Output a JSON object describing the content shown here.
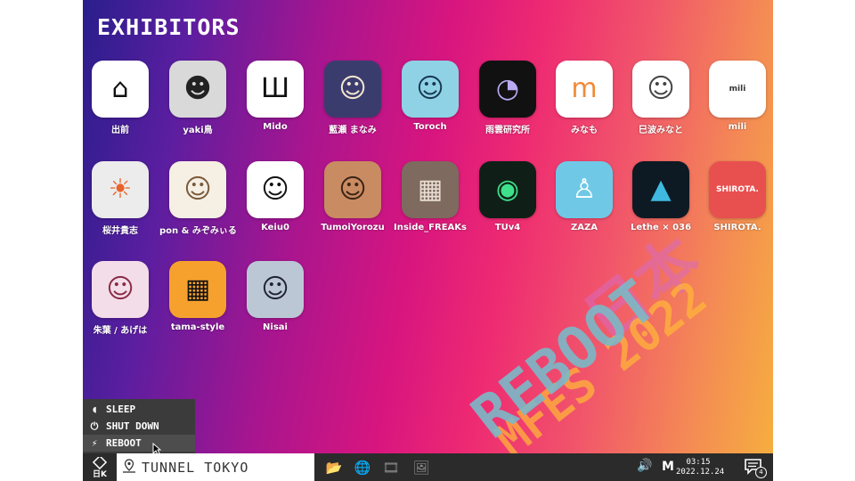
{
  "desktop": {
    "title": "EXHIBITORS",
    "apps": [
      {
        "label": "出前",
        "tile_bg": "#ffffff",
        "tile_fg": "#111111",
        "glyph": "⌂"
      },
      {
        "label": "yaki鳥",
        "tile_bg": "#d9d9d9",
        "tile_fg": "#222222",
        "glyph": "☻"
      },
      {
        "label": "Mido",
        "tile_bg": "#ffffff",
        "tile_fg": "#111111",
        "glyph": "Ш"
      },
      {
        "label": "藍瀬 まなみ",
        "tile_bg": "#3b3c6e",
        "tile_fg": "#f3e6d0",
        "glyph": "☺"
      },
      {
        "label": "Toroch",
        "tile_bg": "#8fd2e6",
        "tile_fg": "#17384f",
        "glyph": "☺"
      },
      {
        "label": "雨雲研究所",
        "tile_bg": "#111111",
        "tile_fg": "#b9a9f3",
        "glyph": "◔"
      },
      {
        "label": "みなも",
        "tile_bg": "#ffffff",
        "tile_fg": "#f08b3a",
        "glyph": "m"
      },
      {
        "label": "巳波みなと",
        "tile_bg": "#ffffff",
        "tile_fg": "#444444",
        "glyph": "☺"
      },
      {
        "label": "mili",
        "tile_bg": "#ffffff",
        "tile_fg": "#333333",
        "glyph": "mili"
      },
      {
        "label": "桜井貴志",
        "tile_bg": "#ececec",
        "tile_fg": "#e8632a",
        "glyph": "☀"
      },
      {
        "label": "pon & みぞみぃる",
        "tile_bg": "#f5efe4",
        "tile_fg": "#7a5a3a",
        "glyph": "☺"
      },
      {
        "label": "Keiu0",
        "tile_bg": "#ffffff",
        "tile_fg": "#111111",
        "glyph": "☺"
      },
      {
        "label": "TumoiYorozu",
        "tile_bg": "#c98b62",
        "tile_fg": "#3a2315",
        "glyph": "☺"
      },
      {
        "label": "Inside_FREAKs",
        "tile_bg": "#7e6a5f",
        "tile_fg": "#e8ddd2",
        "glyph": "▦"
      },
      {
        "label": "TUv4",
        "tile_bg": "#0f1f17",
        "tile_fg": "#3fe08a",
        "glyph": "◉"
      },
      {
        "label": "ZAZA",
        "tile_bg": "#6fc9e6",
        "tile_fg": "#ffffff",
        "glyph": "♙"
      },
      {
        "label": "Lethe × 036",
        "tile_bg": "#0d1a24",
        "tile_fg": "#3fb9e0",
        "glyph": "▲"
      },
      {
        "label": "SHIROTA.",
        "tile_bg": "#e8504f",
        "tile_fg": "#ffffff",
        "glyph": "SHIROTA."
      },
      {
        "label": "朱葉 / あげは",
        "tile_bg": "#f3dde8",
        "tile_fg": "#8a2b46",
        "glyph": "☺"
      },
      {
        "label": "tama-style",
        "tile_bg": "#f6a12e",
        "tile_fg": "#111111",
        "glyph": "▦"
      },
      {
        "label": "Nisai",
        "tile_bg": "#bcc7d6",
        "tile_fg": "#1f2430",
        "glyph": "☺"
      }
    ]
  },
  "decoration": {
    "line1": "REBOOT",
    "line2": "MFES 2022",
    "line3": "日本"
  },
  "power_menu": {
    "items": [
      {
        "label": "SLEEP",
        "icon": "moon-icon"
      },
      {
        "label": "SHUT DOWN",
        "icon": "power-icon"
      },
      {
        "label": "REBOOT",
        "icon": "bolt-icon"
      }
    ]
  },
  "taskbar": {
    "start_logo": "日K",
    "location": "TUNNEL TOKYO",
    "pinned": [
      "folder-icon",
      "globe-icon",
      "film-icon",
      "image-icon"
    ],
    "ime": "M",
    "time": "03:15",
    "date": "2022.12.24",
    "notifications": "4"
  }
}
